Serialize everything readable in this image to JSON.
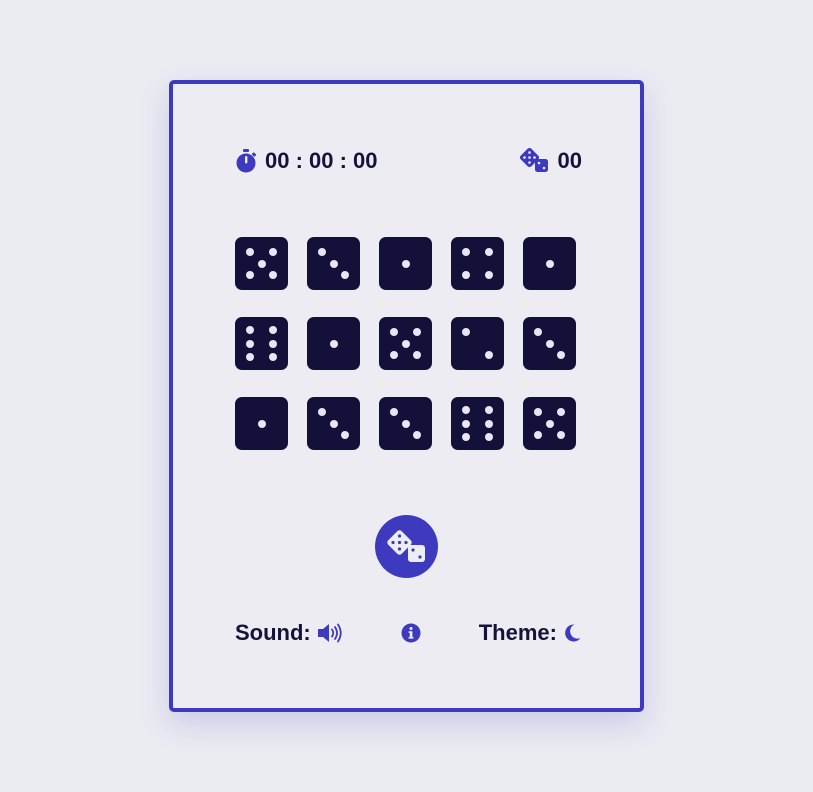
{
  "timer": {
    "value": "00 : 00 : 00",
    "icon": "stopwatch-icon"
  },
  "rolls": {
    "count": "00",
    "icon": "dice-icon"
  },
  "dice": [
    5,
    3,
    1,
    4,
    1,
    6,
    1,
    5,
    2,
    3,
    1,
    3,
    3,
    6,
    5
  ],
  "roll_button": {
    "icon": "dice-icon"
  },
  "footer": {
    "sound_label": "Sound:",
    "sound_icon": "volume-icon",
    "info_icon": "info-icon",
    "theme_label": "Theme:",
    "theme_icon": "moon-icon"
  },
  "colors": {
    "accent": "#3d3ac0",
    "die": "#13103a",
    "pip": "#e8e6f3",
    "background": "#ebebf2",
    "text": "#15133a"
  }
}
